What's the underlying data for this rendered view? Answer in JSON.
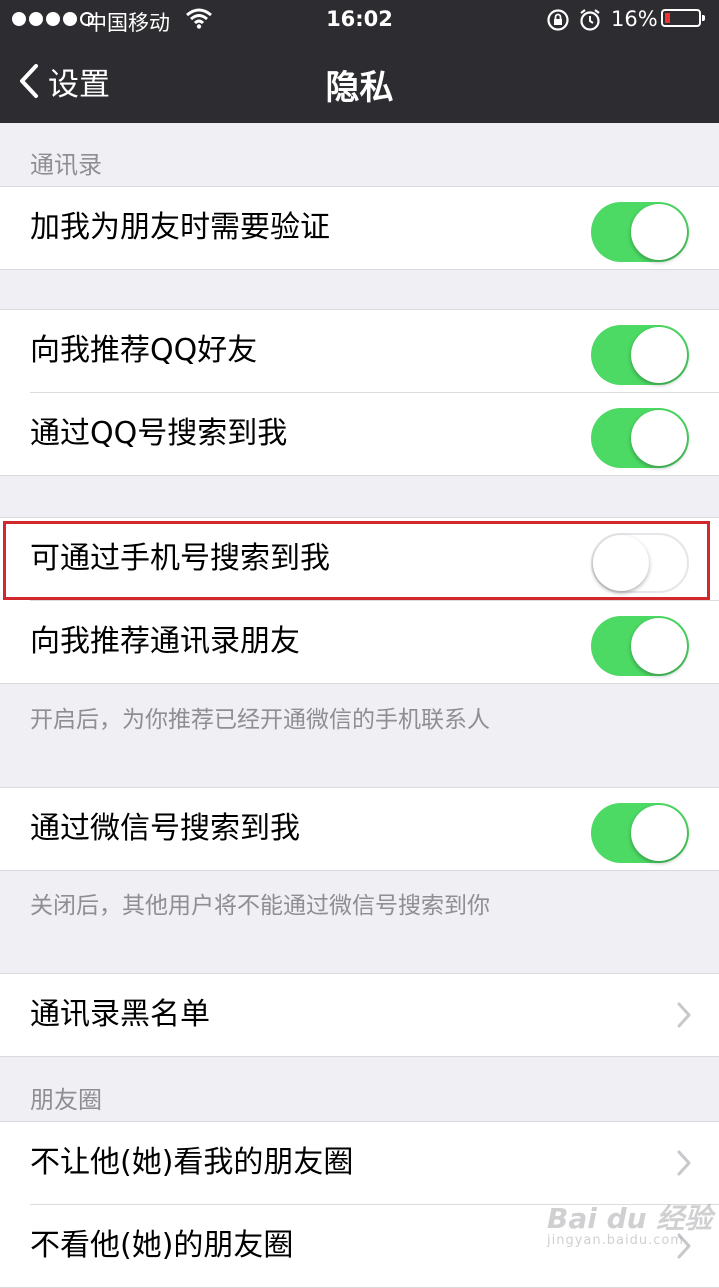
{
  "status_bar": {
    "carrier": "中国移动",
    "time": "16:02",
    "battery": "16%",
    "battery_level": 0.16,
    "icons": [
      "signal-dots-icon",
      "wifi-icon",
      "rotation-lock-icon",
      "alarm-icon",
      "battery-icon"
    ]
  },
  "nav": {
    "back_label": "设置",
    "title": "隐私"
  },
  "sections": {
    "contacts_header": "通讯录",
    "moments_header": "朋友圈"
  },
  "rows": {
    "verify_friend": {
      "label": "加我为朋友时需要验证",
      "on": true
    },
    "recommend_qq": {
      "label": "向我推荐QQ好友",
      "on": true
    },
    "search_by_qq": {
      "label": "通过QQ号搜索到我",
      "on": true
    },
    "search_by_phone": {
      "label": "可通过手机号搜索到我",
      "on": false
    },
    "recommend_contacts": {
      "label": "向我推荐通讯录朋友",
      "on": true
    },
    "search_by_wechat": {
      "label": "通过微信号搜索到我",
      "on": true
    },
    "contacts_blacklist": {
      "label": "通讯录黑名单"
    },
    "hide_my_moments": {
      "label": "不让他(她)看我的朋友圈"
    },
    "hide_their_moments": {
      "label": "不看他(她)的朋友圈"
    }
  },
  "notes": {
    "recommend_contacts_note": "开启后，为你推荐已经开通微信的手机联系人",
    "search_by_wechat_note": "关闭后，其他用户将不能通过微信号搜索到你"
  },
  "colors": {
    "toggle_on": "#4cd964",
    "nav_bg": "#2d2d31",
    "highlight": "#d0282c",
    "background": "#efeff4"
  },
  "watermark": {
    "main": "Bai du 经验",
    "sub": "jingyan.baidu.com"
  }
}
